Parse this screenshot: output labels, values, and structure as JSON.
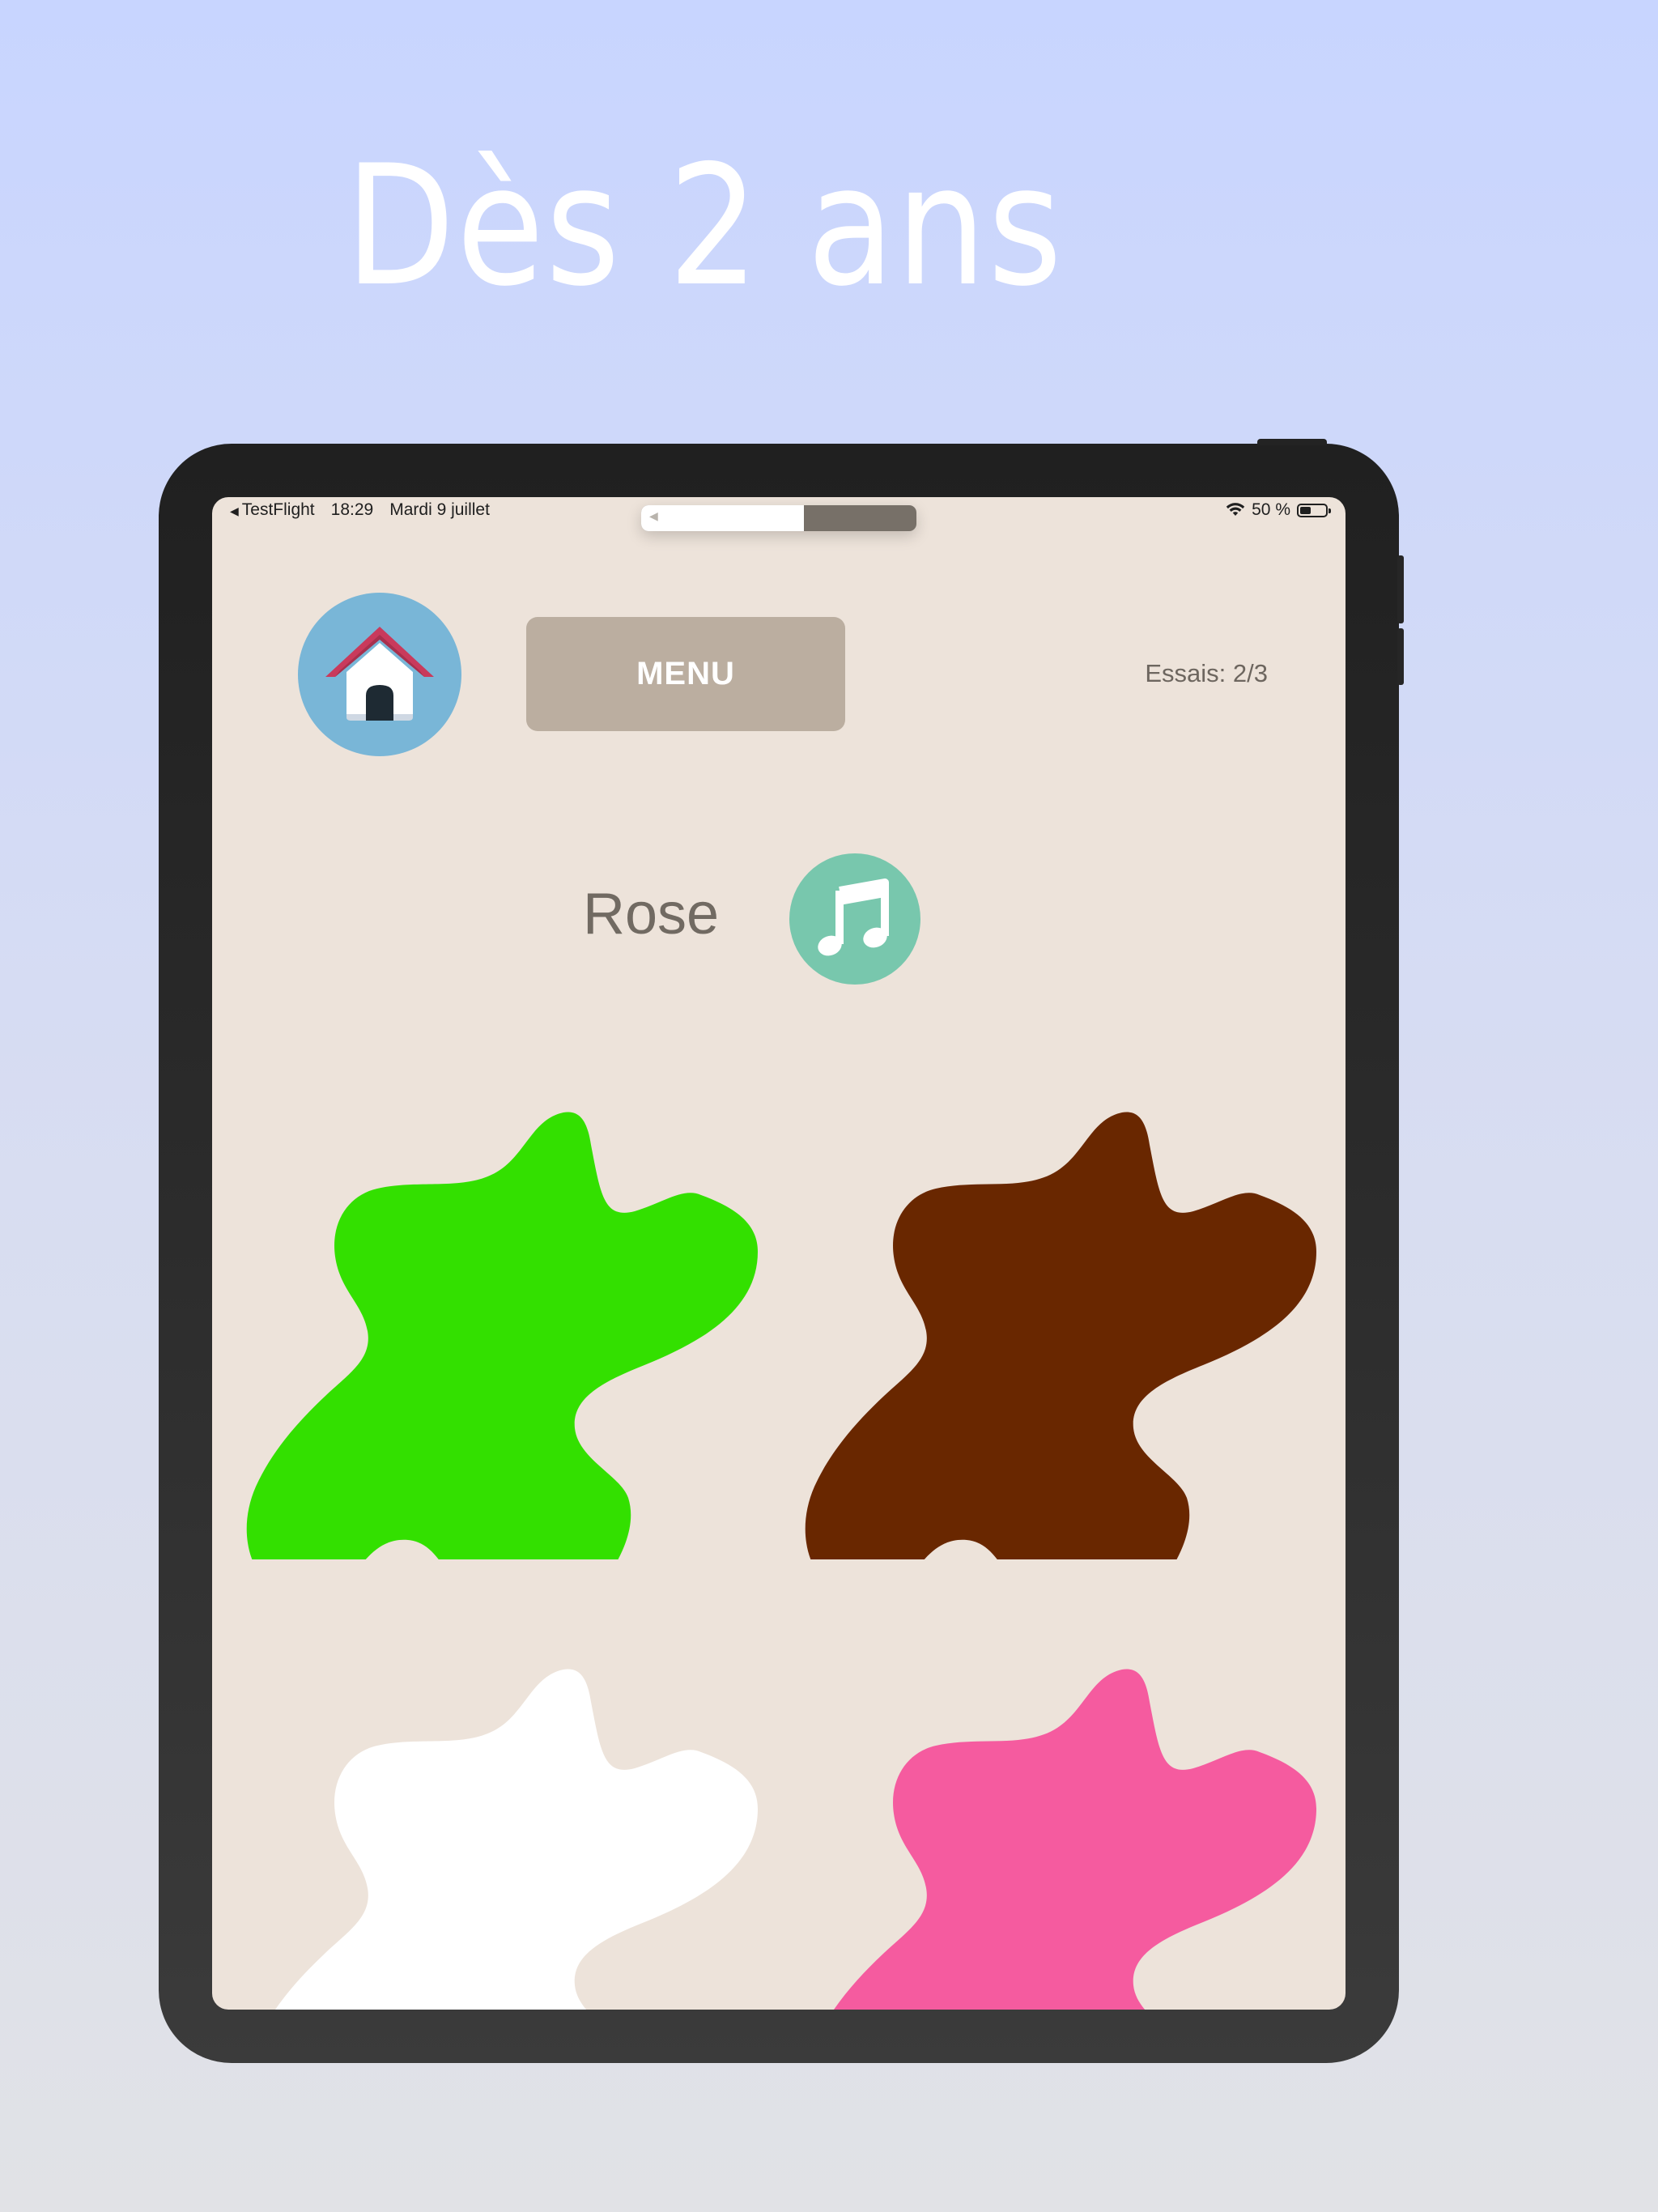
{
  "headline": "Dès 2 ans",
  "status_bar": {
    "back_app": "TestFlight",
    "time": "18:29",
    "date": "Mardi 9 juillet",
    "battery_text": "50 %",
    "battery_level": 0.5,
    "volume_level": 0.59
  },
  "toolbar": {
    "home_icon": "house-icon",
    "menu_label": "MENU",
    "tries_text": "Essais: 2/3"
  },
  "prompt": {
    "color_word": "Rose",
    "sound_icon": "music-note-icon"
  },
  "blobs": [
    {
      "name": "green-blob",
      "color": "#33e000"
    },
    {
      "name": "brown-blob",
      "color": "#692700"
    },
    {
      "name": "white-blob",
      "color": "#ffffff"
    },
    {
      "name": "pink-blob",
      "color": "#f55b9f"
    }
  ]
}
